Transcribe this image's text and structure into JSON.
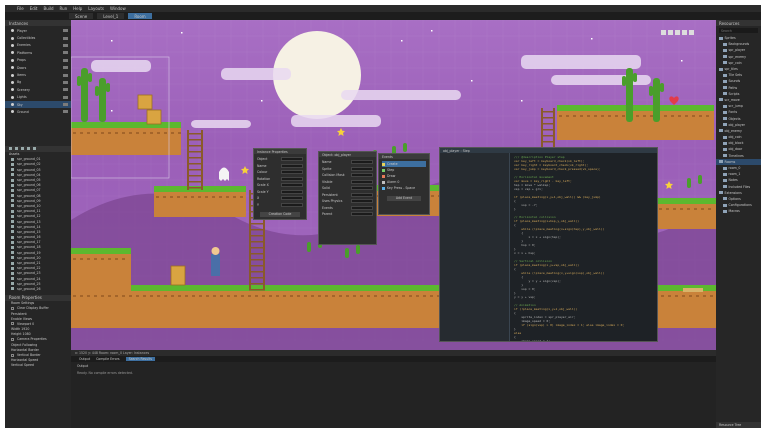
{
  "menu": [
    "File",
    "Edit",
    "Build",
    "Run",
    "Help",
    "Layouts",
    "Window"
  ],
  "tabs": [
    "Scene",
    "Level_1",
    "Room"
  ],
  "left_panel": {
    "title": "Instances",
    "layers": [
      "Player",
      "Collectibles",
      "Enemies",
      "Platforms",
      "Props",
      "Doors",
      "Items",
      "Bg",
      "Scenery",
      "Lights",
      "Sky",
      "Ground"
    ],
    "selected_layer": 10,
    "assets_title": "Assets",
    "assets": [
      "spr_ground_01",
      "spr_ground_02",
      "spr_ground_03",
      "spr_ground_04",
      "spr_ground_05",
      "spr_ground_06",
      "spr_ground_07",
      "spr_ground_08",
      "spr_ground_09",
      "spr_ground_10",
      "spr_ground_11",
      "spr_ground_12",
      "spr_ground_13",
      "spr_ground_14",
      "spr_ground_15",
      "spr_ground_16",
      "spr_ground_17",
      "spr_ground_18",
      "spr_ground_19",
      "spr_ground_20",
      "spr_ground_21",
      "spr_ground_22",
      "spr_ground_23",
      "spr_ground_24",
      "spr_ground_25",
      "spr_ground_26"
    ],
    "props_title": "Room Properties",
    "props": [
      "Room Settings",
      "Clear Display Buffer",
      "Persistent",
      "Enable Views",
      "Viewport 0",
      "Width 1920",
      "Height 1080",
      "Camera Properties",
      "Object Following",
      "Horizontal Border",
      "Vertical Border",
      "Horizontal Speed",
      "Vertical Speed"
    ]
  },
  "right_panel": {
    "title": "Resources",
    "search_placeholder": "Search",
    "items": [
      "Sprites",
      "Backgrounds",
      "spr_player",
      "spr_enemy",
      "spr_coin",
      "spr_tiles",
      "Tile Sets",
      "Sounds",
      "Paths",
      "Scripts",
      "scr_move",
      "scr_jump",
      "Fonts",
      "Objects",
      "obj_player",
      "obj_enemy",
      "obj_coin",
      "obj_block",
      "obj_door",
      "Timelines",
      "Rooms",
      "room_0",
      "room_1",
      "Notes",
      "Included Files",
      "Extensions",
      "Options",
      "Configurations",
      "Macros"
    ],
    "selected_item": 20,
    "footer": "Resource Tree"
  },
  "windows": {
    "instance": {
      "title": "Instance Properties",
      "fields": [
        "Object",
        "Name",
        "Colour",
        "Rotation",
        "Scale X",
        "Scale Y",
        "X",
        "Y"
      ],
      "button": "Creation Code"
    },
    "object": {
      "title": "Object: obj_player",
      "fields": [
        "Name",
        "Sprite",
        "Collision Mask",
        "Visible",
        "Solid",
        "Persistent",
        "Uses Physics",
        "Events",
        "Parent"
      ]
    },
    "events": {
      "title": "Events",
      "items": [
        "Create",
        "Step",
        "Draw",
        "Alarm 0",
        "Key Press - Space"
      ],
      "button": "Add Event"
    },
    "code": {
      "title": "obj_player : Step",
      "lines": [
        "/// @description Player step",
        "var key_left = keyboard_check(vk_left);",
        "var key_right = keyboard_check(vk_right);",
        "var key_jump = keyboard_check_pressed(vk_space);",
        "",
        "// Horizontal movement",
        "var move = key_right - key_left;",
        "hsp = move * walksp;",
        "vsp = vsp + grv;",
        "",
        "if (place_meeting(x,y+1,obj_wall)) && (key_jump)",
        "{",
        "    vsp = -7;",
        "}",
        "",
        "// Horizontal collision",
        "if (place_meeting(x+hsp,y,obj_wall))",
        "{",
        "    while (!place_meeting(x+sign(hsp),y,obj_wall))",
        "    {",
        "        x = x + sign(hsp);",
        "    }",
        "    hsp = 0;",
        "}",
        "x = x + hsp;",
        "",
        "// Vertical collision",
        "if (place_meeting(x,y+vsp,obj_wall))",
        "{",
        "    while (!place_meeting(x,y+sign(vsp),obj_wall))",
        "    {",
        "        y = y + sign(vsp);",
        "    }",
        "    vsp = 0;",
        "}",
        "y = y + vsp;",
        "",
        "// Animation",
        "if (!place_meeting(x,y+1,obj_wall))",
        "{",
        "    sprite_index = spr_player_air;",
        "    image_speed = 0;",
        "    if (sign(vsp) > 0) image_index = 1; else image_index = 0;",
        "}",
        "else",
        "{",
        "    image_speed = 1;",
        "    if (hsp == 0) sprite_index = spr_player;",
        "    else sprite_index = spr_player_run;",
        "}",
        "if (hsp != 0) image_xscale = sign(hsp);"
      ]
    }
  },
  "status": "x: 1520  y: 448   Room: room_0   Layer: Instances",
  "output": {
    "tabs": [
      "Output",
      "Compile Errors",
      "Search Results"
    ],
    "title": "Output",
    "text": "Ready. No compile errors detected."
  },
  "colors": {
    "sky": "#a86fc4",
    "grass": "#5cb82f",
    "dirt": "#c9823a",
    "moon": "#f6f1e4",
    "accent": "#2c4a6b"
  }
}
